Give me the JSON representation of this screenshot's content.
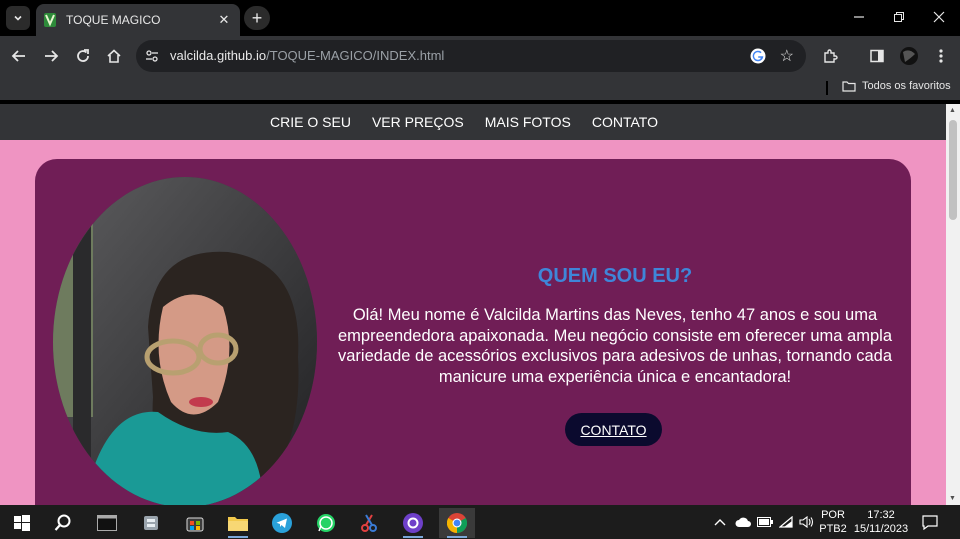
{
  "browser": {
    "tab": {
      "title": "TOQUE MAGICO",
      "favicon": "green-book-icon"
    },
    "url_domain": "valcilda.github.io",
    "url_path": "/TOQUE-MAGICO/INDEX.html",
    "bookmarks_folder": "Todos os favoritos"
  },
  "site": {
    "nav": [
      "CRIE O SEU",
      "VER PREÇOS",
      "MAIS FOTOS",
      "CONTATO"
    ],
    "hero": {
      "title": "QUEM SOU EU?",
      "text": "Olá! Meu nome é Valcilda Martins das Neves, tenho 47 anos e sou uma empreendedora apaixonada. Meu negócio consiste em oferecer uma ampla variedade de acessórios exclusivos para adesivos de unhas, tornando cada manicure uma experiência única e encantadora!",
      "button": "CONTATO"
    },
    "colors": {
      "page_bg": "#ef94c2",
      "card_bg": "#701e56",
      "title": "#3f86d9",
      "button_bg": "#0b0a2e",
      "nav_bg": "#333437"
    }
  },
  "taskbar": {
    "apps": [
      "windows-start-icon",
      "search-icon",
      "terminal-icon",
      "file-cabinet-icon",
      "store-icon",
      "file-explorer-icon",
      "telegram-icon",
      "whatsapp-icon",
      "scissors-app-icon",
      "github-icon",
      "chrome-icon"
    ],
    "lang_line1": "POR",
    "lang_line2": "PTB2",
    "time": "17:32",
    "date": "15/11/2023"
  }
}
